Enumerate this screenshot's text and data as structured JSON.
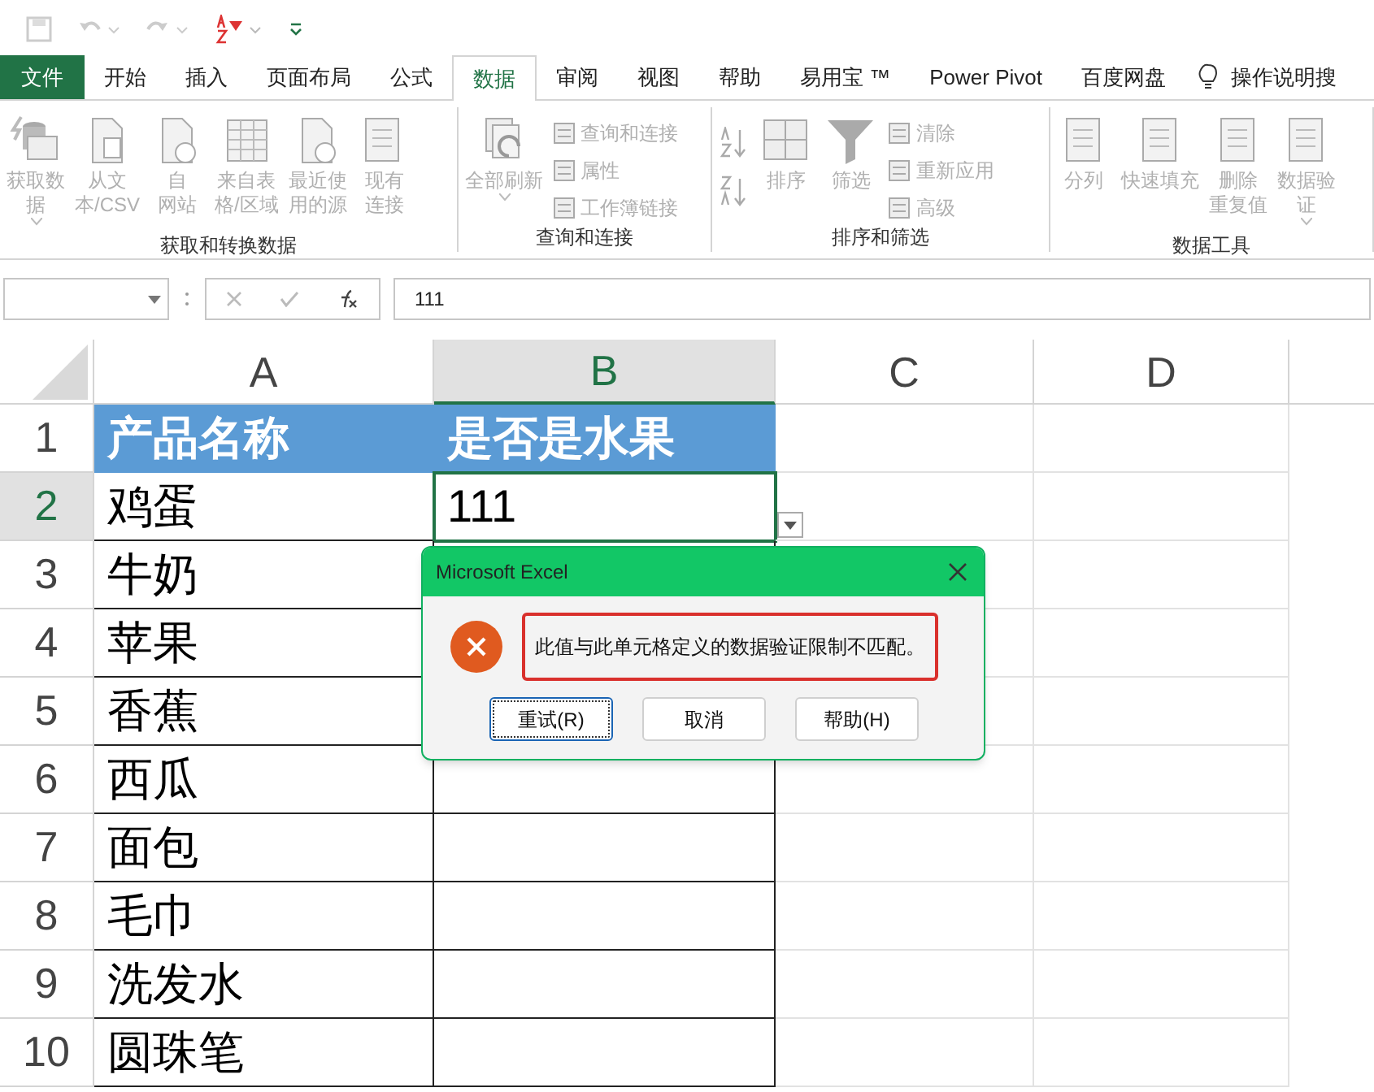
{
  "tabs": [
    {
      "label": "文件",
      "selected": false,
      "kind": "file"
    },
    {
      "label": "开始",
      "selected": false,
      "kind": "tab"
    },
    {
      "label": "插入",
      "selected": false,
      "kind": "tab"
    },
    {
      "label": "页面布局",
      "selected": false,
      "kind": "tab"
    },
    {
      "label": "公式",
      "selected": false,
      "kind": "tab"
    },
    {
      "label": "数据",
      "selected": true,
      "kind": "tab"
    },
    {
      "label": "审阅",
      "selected": false,
      "kind": "tab"
    },
    {
      "label": "视图",
      "selected": false,
      "kind": "tab"
    },
    {
      "label": "帮助",
      "selected": false,
      "kind": "tab"
    },
    {
      "label": "易用宝 ™",
      "selected": false,
      "kind": "tab"
    },
    {
      "label": "Power Pivot",
      "selected": false,
      "kind": "tab"
    },
    {
      "label": "百度网盘",
      "selected": false,
      "kind": "tab"
    }
  ],
  "tell_me": "操作说明搜",
  "ribbon_groups": [
    {
      "label": "获取和转换数据",
      "items": [
        {
          "kind": "large",
          "lines": [
            "获取数",
            "据"
          ],
          "dropdown": true
        },
        {
          "kind": "large",
          "lines": [
            "从文",
            "本/CSV"
          ]
        },
        {
          "kind": "large",
          "lines": [
            "自",
            "网站"
          ]
        },
        {
          "kind": "large",
          "lines": [
            "来自表",
            "格/区域"
          ]
        },
        {
          "kind": "large",
          "lines": [
            "最近使",
            "用的源"
          ]
        },
        {
          "kind": "large",
          "lines": [
            "现有",
            "连接"
          ]
        }
      ]
    },
    {
      "label": "查询和连接",
      "items": [
        {
          "kind": "large",
          "lines": [
            "全部刷新"
          ],
          "dropdown": true
        },
        {
          "kind": "small",
          "lines": [
            "查询和连接"
          ]
        },
        {
          "kind": "small",
          "lines": [
            "属性"
          ]
        },
        {
          "kind": "small",
          "lines": [
            "工作簿链接"
          ]
        }
      ]
    },
    {
      "label": "排序和筛选",
      "items": [
        {
          "kind": "sortpair"
        },
        {
          "kind": "large",
          "lines": [
            "排序"
          ]
        },
        {
          "kind": "large",
          "lines": [
            "筛选"
          ]
        },
        {
          "kind": "small",
          "lines": [
            "清除"
          ]
        },
        {
          "kind": "small",
          "lines": [
            "重新应用"
          ]
        },
        {
          "kind": "small",
          "lines": [
            "高级"
          ]
        }
      ]
    },
    {
      "label": "数据工具",
      "items": [
        {
          "kind": "large",
          "lines": [
            "分列"
          ]
        },
        {
          "kind": "large",
          "lines": [
            "快速填充"
          ]
        },
        {
          "kind": "large",
          "lines": [
            "删除",
            "重复值"
          ]
        },
        {
          "kind": "large",
          "lines": [
            "数据验",
            "证"
          ],
          "dropdown": true
        }
      ]
    }
  ],
  "formula_bar": {
    "formula": "111"
  },
  "columns": [
    {
      "label": "A",
      "selected": false
    },
    {
      "label": "B",
      "selected": true
    },
    {
      "label": "C",
      "selected": false
    },
    {
      "label": "D",
      "selected": false
    }
  ],
  "rows": [
    {
      "number": "1",
      "kind": "header",
      "selected": false,
      "cells": [
        "产品名称",
        "是否是水果"
      ]
    },
    {
      "number": "2",
      "kind": "data",
      "selected": true,
      "cells": [
        "鸡蛋",
        "111"
      ]
    },
    {
      "number": "3",
      "kind": "data",
      "selected": false,
      "cells": [
        "牛奶",
        ""
      ]
    },
    {
      "number": "4",
      "kind": "data",
      "selected": false,
      "cells": [
        "苹果",
        ""
      ]
    },
    {
      "number": "5",
      "kind": "data",
      "selected": false,
      "cells": [
        "香蕉",
        ""
      ]
    },
    {
      "number": "6",
      "kind": "data",
      "selected": false,
      "cells": [
        "西瓜",
        ""
      ]
    },
    {
      "number": "7",
      "kind": "data",
      "selected": false,
      "cells": [
        "面包",
        ""
      ]
    },
    {
      "number": "8",
      "kind": "data",
      "selected": false,
      "cells": [
        "毛巾",
        ""
      ]
    },
    {
      "number": "9",
      "kind": "data",
      "selected": false,
      "cells": [
        "洗发水",
        ""
      ]
    },
    {
      "number": "10",
      "kind": "data",
      "selected": false,
      "cells": [
        "圆珠笔",
        ""
      ]
    }
  ],
  "dialog": {
    "title": "Microsoft Excel",
    "message": "此值与此单元格定义的数据验证限制不匹配。",
    "buttons": [
      {
        "label": "重试(R)",
        "selected": true
      },
      {
        "label": "取消",
        "selected": false
      },
      {
        "label": "帮助(H)",
        "selected": false
      }
    ]
  }
}
